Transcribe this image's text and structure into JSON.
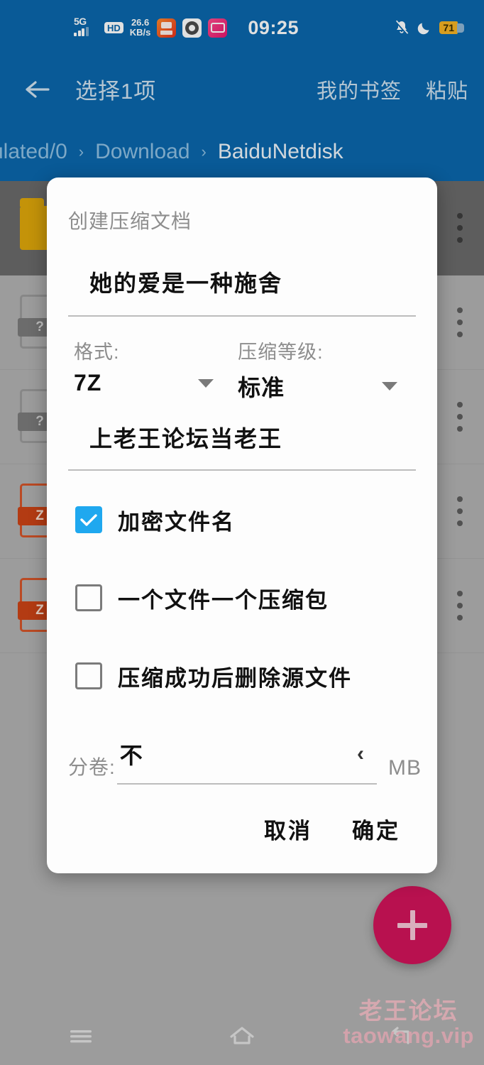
{
  "statusbar": {
    "network_type": "5G",
    "hd_label": "HD",
    "net_speed_value": "26.6",
    "net_speed_unit": "KB/s",
    "app_icons": [
      "qq-icon",
      "chrome-icon",
      "bilibili-icon"
    ],
    "time": "09:25",
    "bell_icon": "bell-muted-icon",
    "moon_icon": "moon-dnd-icon",
    "battery_percent": "71"
  },
  "toolbar": {
    "back_icon": "back-arrow-icon",
    "title": "选择1项",
    "actions": [
      {
        "label": "我的书签",
        "name": "my-bookmarks-button"
      },
      {
        "label": "粘贴",
        "name": "paste-button"
      }
    ]
  },
  "breadcrumb": {
    "separator": "›",
    "segments": [
      {
        "label": "ulated/0",
        "current": false
      },
      {
        "label": "Download",
        "current": false
      },
      {
        "label": "BaiduNetdisk",
        "current": true
      }
    ]
  },
  "filelist": {
    "rows": [
      {
        "icon": "folder-icon",
        "icon_kind": "folder",
        "badge": "",
        "selected": true
      },
      {
        "icon": "unknown-file-icon",
        "icon_kind": "doc",
        "badge": "?",
        "selected": false
      },
      {
        "icon": "unknown-file-icon",
        "icon_kind": "doc",
        "badge": "?",
        "selected": false
      },
      {
        "icon": "zip-file-icon",
        "icon_kind": "zip",
        "badge": "Z",
        "selected": false
      },
      {
        "icon": "zip-file-icon",
        "icon_kind": "zip",
        "badge": "Z",
        "selected": false
      }
    ],
    "overflow_icon": "more-vertical-icon"
  },
  "fab": {
    "icon": "plus-icon",
    "color": "#d2145a"
  },
  "navbar": {
    "items": [
      {
        "name": "nav-recents",
        "icon": "menu-icon"
      },
      {
        "name": "nav-home",
        "icon": "home-icon"
      },
      {
        "name": "nav-back",
        "icon": "back-icon"
      }
    ]
  },
  "watermark": {
    "line1": "老王论坛",
    "line2": "taowang.vip",
    "color": "#f3c0c8"
  },
  "dialog": {
    "title": "创建压缩文档",
    "archive_name": {
      "value": "她的爱是一种施舍"
    },
    "format": {
      "label": "格式:",
      "value": "7Z",
      "caret_icon": "chevron-down-icon"
    },
    "level": {
      "label": "压缩等级:",
      "value": "标准",
      "caret_icon": "chevron-down-icon"
    },
    "password": {
      "value": "上老王论坛当老王"
    },
    "checkboxes": [
      {
        "label": "加密文件名",
        "checked": true,
        "name": "encrypt-filenames-checkbox"
      },
      {
        "label": "一个文件一个压缩包",
        "checked": false,
        "name": "one-archive-per-file-checkbox"
      },
      {
        "label": "压缩成功后删除源文件",
        "checked": false,
        "name": "delete-source-after-checkbox"
      }
    ],
    "split": {
      "label": "分卷:",
      "value": "不",
      "chevron": "‹",
      "unit": "MB"
    },
    "buttons": {
      "cancel": "取消",
      "confirm": "确定"
    },
    "accent_color": "#1fa8ef"
  }
}
